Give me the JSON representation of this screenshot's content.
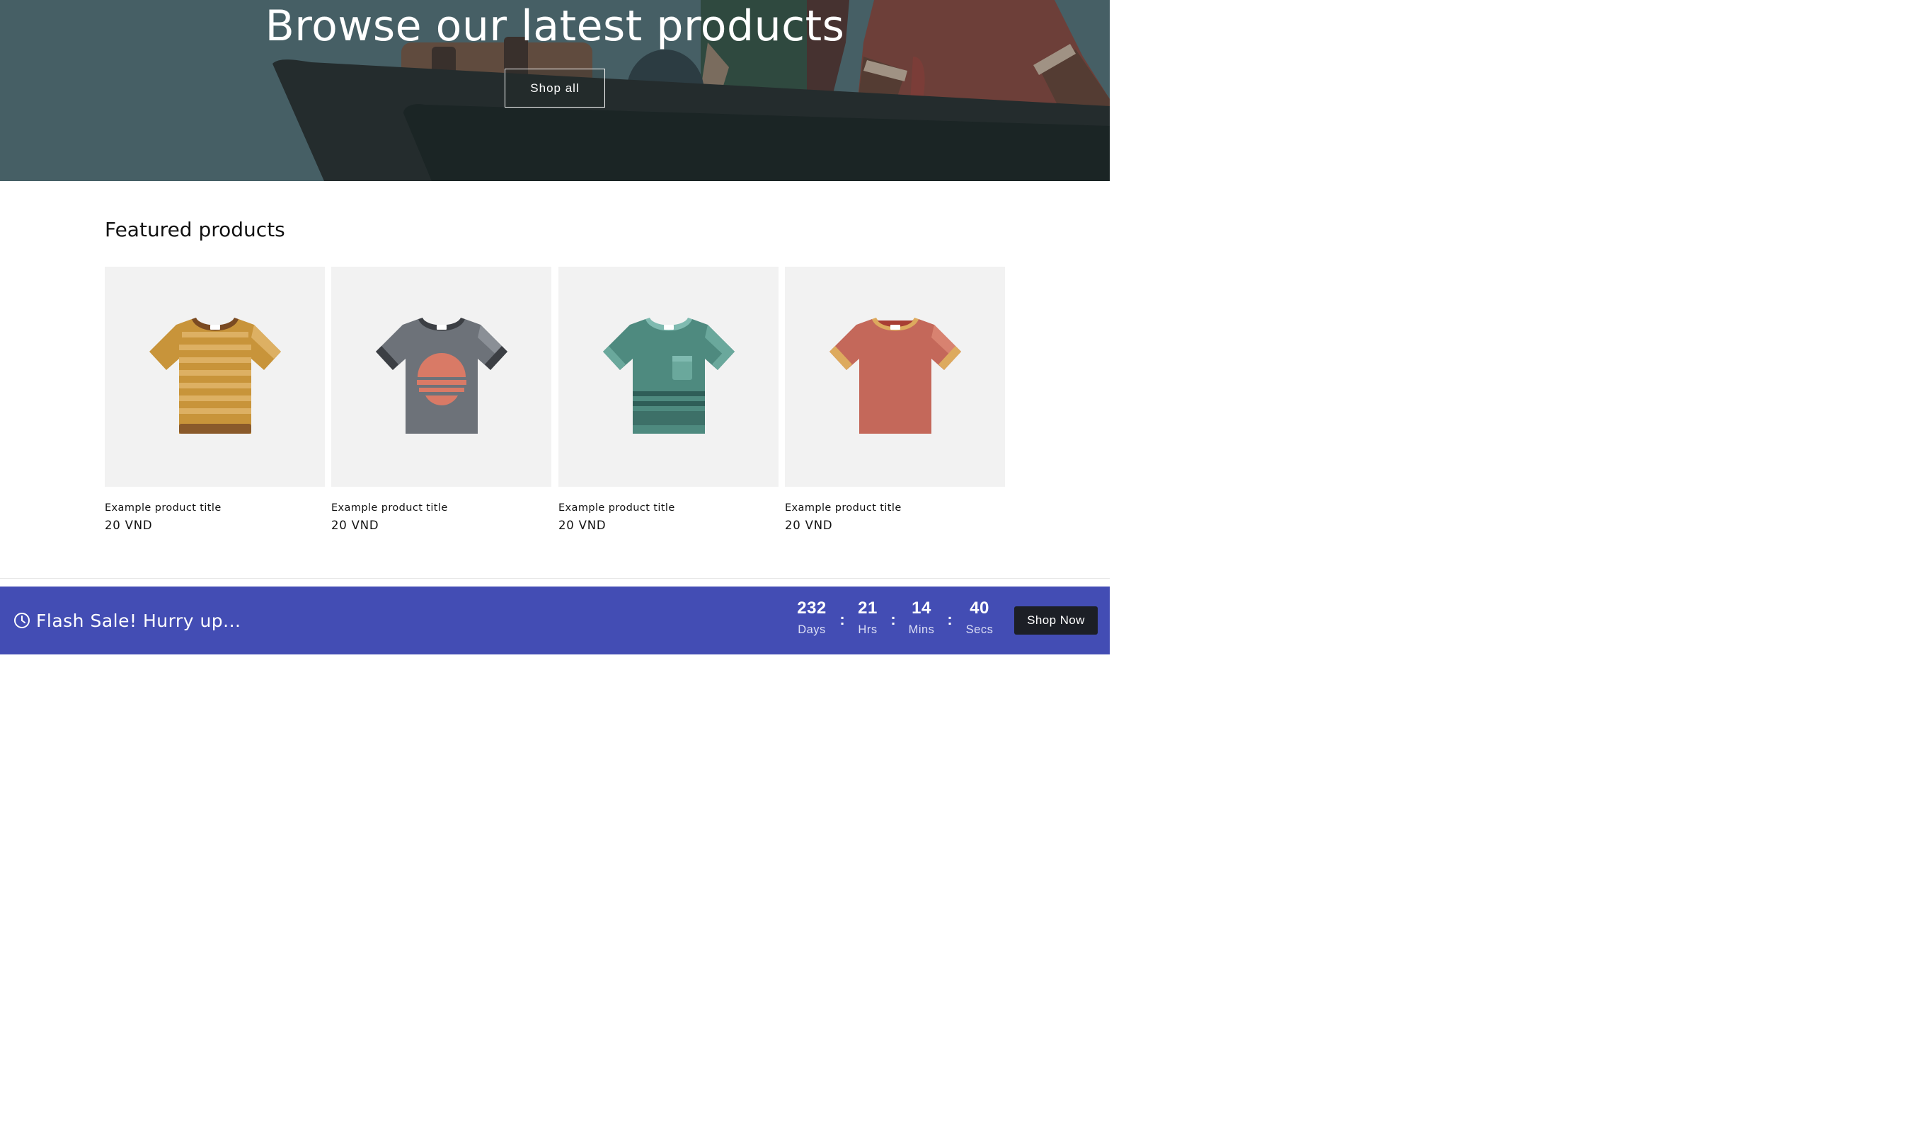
{
  "hero": {
    "title": "Browse our latest products",
    "button_label": "Shop all"
  },
  "featured": {
    "heading": "Featured products",
    "products": [
      {
        "title": "Example product title",
        "price": "20 VND",
        "color": "#c8943a",
        "image": "yellow-striped-tshirt"
      },
      {
        "title": "Example product title",
        "price": "20 VND",
        "color": "#6d7279",
        "image": "gray-sunset-tshirt"
      },
      {
        "title": "Example product title",
        "price": "20 VND",
        "color": "#4e8a7f",
        "image": "teal-pocket-tshirt"
      },
      {
        "title": "Example product title",
        "price": "20 VND",
        "color": "#c4685a",
        "image": "red-ringer-tshirt"
      }
    ]
  },
  "flash_sale": {
    "label": "Flash Sale! Hurry up...",
    "icon": "clock-icon",
    "background": "#434db4",
    "countdown": {
      "days": {
        "value": "232",
        "label": "Days"
      },
      "hours": {
        "value": "21",
        "label": "Hrs"
      },
      "mins": {
        "value": "14",
        "label": "Mins"
      },
      "secs": {
        "value": "40",
        "label": "Secs"
      },
      "separator": ":"
    },
    "button_label": "Shop Now"
  }
}
